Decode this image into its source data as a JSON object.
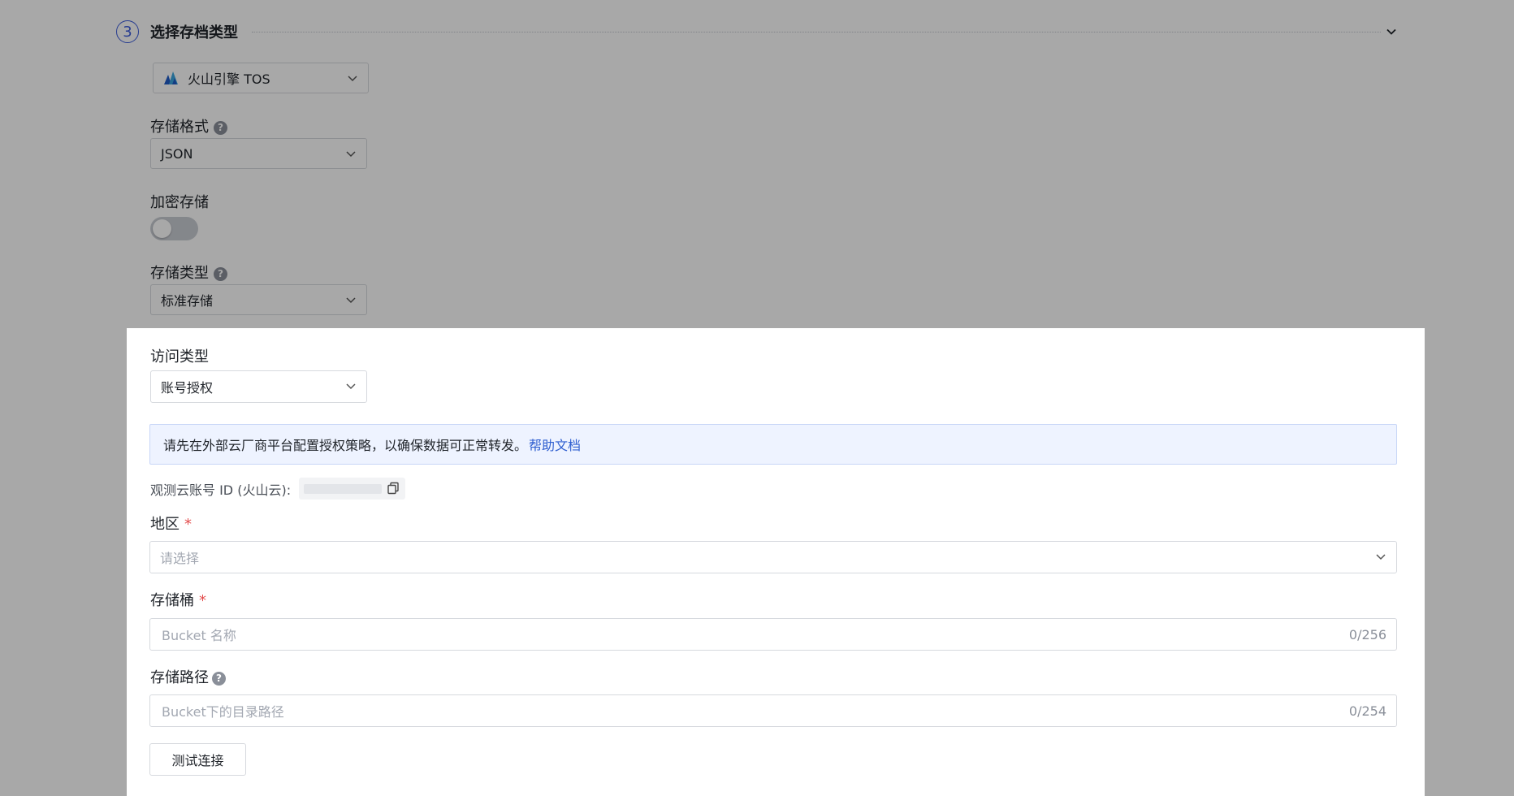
{
  "section": {
    "step_number": "3",
    "title": "选择存档类型"
  },
  "provider_select": {
    "value": "火山引擎 TOS",
    "logo_icon": "volcengine-logo-icon"
  },
  "storage_format": {
    "label": "存储格式",
    "value": "JSON"
  },
  "encryption": {
    "label": "加密存储",
    "enabled": false
  },
  "storage_class": {
    "label": "存储类型",
    "value": "标准存储"
  },
  "access_type": {
    "label": "访问类型",
    "value": "账号授权"
  },
  "notice": {
    "text": "请先在外部云厂商平台配置授权策略，以确保数据可正常转发。",
    "link": "帮助文档"
  },
  "account_id": {
    "label": "观测云账号 ID (火山云):"
  },
  "region": {
    "label": "地区",
    "required": "*",
    "placeholder": "请选择"
  },
  "bucket": {
    "label": "存储桶",
    "required": "*",
    "placeholder": "Bucket 名称",
    "counter": "0/256"
  },
  "path": {
    "label": "存储路径",
    "placeholder": "Bucket下的目录路径",
    "counter": "0/254"
  },
  "test_button": {
    "label": "测试连接"
  },
  "colors": {
    "accent": "#3b5bdb",
    "link": "#2f5fd0",
    "required": "#e34d4d",
    "notice_bg": "#eef3ff"
  }
}
